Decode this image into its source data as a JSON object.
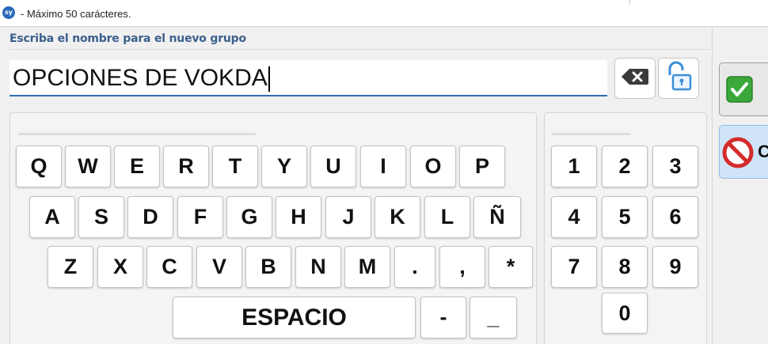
{
  "window": {
    "app_icon_text": "sy",
    "title": "- Máximo 50 carácteres."
  },
  "prompt": "Escriba el nombre para el nuevo grupo",
  "input": {
    "value": "OPCIONES DE VOKDA"
  },
  "icons": {
    "backspace": "backspace-icon",
    "lock": "unlock-icon",
    "ok": "checkmark-icon",
    "cancel": "cancel-icon"
  },
  "keyboard": {
    "row1": [
      "Q",
      "W",
      "E",
      "R",
      "T",
      "Y",
      "U",
      "I",
      "O",
      "P"
    ],
    "row2": [
      "A",
      "S",
      "D",
      "F",
      "G",
      "H",
      "J",
      "K",
      "L",
      "Ñ"
    ],
    "row3": [
      "Z",
      "X",
      "C",
      "V",
      "B",
      "N",
      "M",
      ".",
      ",",
      "*"
    ],
    "space": "ESPACIO",
    "dash": "-",
    "underscore": "_"
  },
  "numpad": {
    "rows": [
      [
        "1",
        "2",
        "3"
      ],
      [
        "4",
        "5",
        "6"
      ],
      [
        "7",
        "8",
        "9"
      ]
    ],
    "zero": "0"
  },
  "side_buttons": {
    "cancel_label": "C"
  },
  "colors": {
    "accent": "#2e6db4",
    "prompt_text": "#3b5f8c",
    "ok_green": "#3aa83a",
    "cancel_red": "#d42b2b",
    "cancel_bg": "#cfe5f7"
  }
}
